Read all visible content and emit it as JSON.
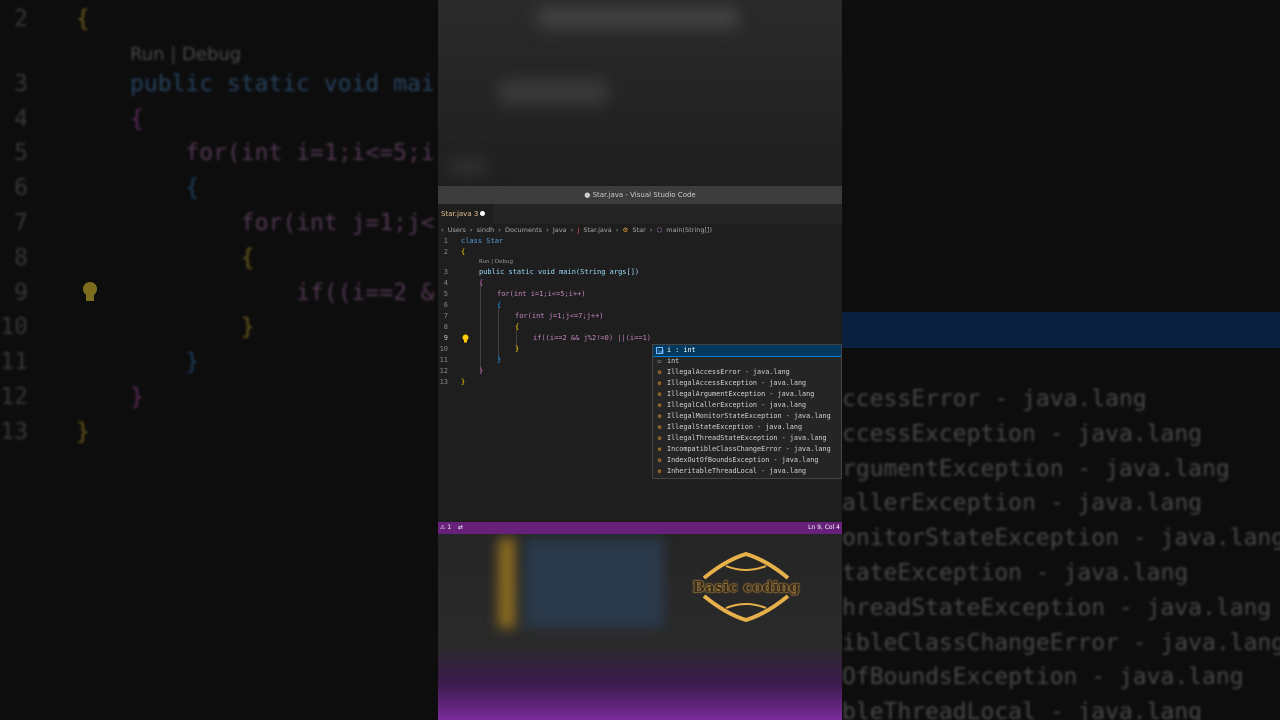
{
  "window": {
    "title": "● Star.java - Visual Studio Code"
  },
  "tab": {
    "label": "Star.java 3"
  },
  "breadcrumb": [
    "Users",
    "sindh",
    "Documents",
    "Java",
    "Star.java",
    "Star",
    "main(String[])"
  ],
  "codelens": "Run | Debug",
  "code_lines": [
    {
      "n": "1",
      "text": "class Star"
    },
    {
      "n": "2",
      "text": "{"
    },
    {
      "n": "3",
      "text": "public static void main(String args[])"
    },
    {
      "n": "4",
      "text": "{"
    },
    {
      "n": "5",
      "text": "for(int i=1;i<=5;i++)"
    },
    {
      "n": "6",
      "text": "{"
    },
    {
      "n": "7",
      "text": "for(int j=1;j<=7;j++)"
    },
    {
      "n": "8",
      "text": "{"
    },
    {
      "n": "9",
      "text": "if((i==2 && j%2!=0) ||(i==1)"
    },
    {
      "n": "10",
      "text": "}"
    },
    {
      "n": "11",
      "text": "}"
    },
    {
      "n": "12",
      "text": "}"
    },
    {
      "n": "13",
      "text": "}"
    }
  ],
  "suggestions": [
    {
      "label": "i : int",
      "kind": "variable"
    },
    {
      "label": "int",
      "kind": "keyword"
    },
    {
      "label": "IllegalAccessError - java.lang",
      "kind": "class"
    },
    {
      "label": "IllegalAccessException - java.lang",
      "kind": "class"
    },
    {
      "label": "IllegalArgumentException - java.lang",
      "kind": "class"
    },
    {
      "label": "IllegalCallerException - java.lang",
      "kind": "class"
    },
    {
      "label": "IllegalMonitorStateException - java.lang",
      "kind": "class"
    },
    {
      "label": "IllegalStateException - java.lang",
      "kind": "class"
    },
    {
      "label": "IllegalThreadStateException - java.lang",
      "kind": "class"
    },
    {
      "label": "IncompatibleClassChangeError - java.lang",
      "kind": "class"
    },
    {
      "label": "IndexOutOfBoundsException - java.lang",
      "kind": "class"
    },
    {
      "label": "InheritableThreadLocal - java.lang",
      "kind": "class"
    }
  ],
  "status": {
    "left": "⚠ 1",
    "right": "Ln 9, Col 4"
  },
  "logo": {
    "text": "Basic coding",
    "color": "#e7b04a"
  },
  "zoom_left": {
    "lines": [
      {
        "n": "2",
        "text": "{"
      },
      {
        "n": "",
        "text": "Run | Debug"
      },
      {
        "n": "3",
        "text": "public static void mai"
      },
      {
        "n": "4",
        "text": "{"
      },
      {
        "n": "5",
        "text": "    for(int i=1;i<=5;i"
      },
      {
        "n": "6",
        "text": "    {"
      },
      {
        "n": "7",
        "text": "        for(int j=1;j<"
      },
      {
        "n": "8",
        "text": "        {"
      },
      {
        "n": "9",
        "text": "            if((i==2 &"
      },
      {
        "n": "10",
        "text": "        }"
      },
      {
        "n": "11",
        "text": "    }"
      },
      {
        "n": "12",
        "text": "}"
      },
      {
        "n": "13",
        "text": "}"
      }
    ]
  },
  "zoom_right": {
    "lines": [
      "ccessError - java.lang",
      "ccessException - java.lang",
      "rgumentException - java.lang",
      "allerException - java.lang",
      "onitorStateException - java.lang",
      "tateException - java.lang",
      "hreadStateException - java.lang",
      "ibleClassChangeError - java.lang",
      "OfBoundsException - java.lang",
      "bleThreadLocal - java.lang"
    ]
  },
  "colors": {
    "status_bar": "#68217a",
    "editor_bg": "#1e1e1e",
    "selection": "#04395e"
  }
}
